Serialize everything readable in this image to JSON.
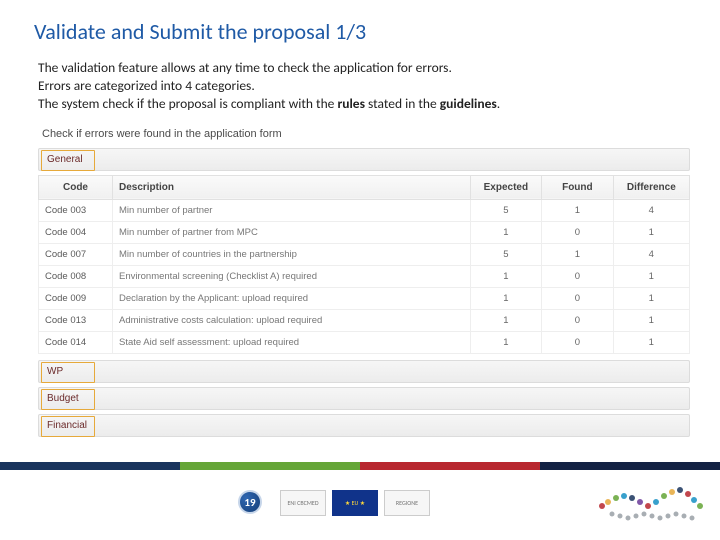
{
  "title": "Validate and Submit the proposal 1/3",
  "intro": {
    "line1": "The validation feature allows at any time to check the application for errors.",
    "line2": "Errors are categorized into 4 categories.",
    "line3a": "The system check if the proposal is compliant with the ",
    "line3b": "rules",
    "line3c": " stated in the ",
    "line3d": "guidelines",
    "line3e": "."
  },
  "panel_header": "Check if errors were found in the application form",
  "categories": {
    "general": "General",
    "wp": "WP",
    "budget": "Budget",
    "financial": "Financial"
  },
  "table": {
    "headers": {
      "code": "Code",
      "desc": "Description",
      "exp": "Expected",
      "found": "Found",
      "diff": "Difference"
    },
    "rows": [
      {
        "code": "Code 003",
        "desc": "Min number of partner",
        "exp": "5",
        "found": "1",
        "diff": "4"
      },
      {
        "code": "Code 004",
        "desc": "Min number of partner from MPC",
        "exp": "1",
        "found": "0",
        "diff": "1"
      },
      {
        "code": "Code 007",
        "desc": "Min number of countries in the partnership",
        "exp": "5",
        "found": "1",
        "diff": "4"
      },
      {
        "code": "Code 008",
        "desc": "Environmental screening (Checklist A) required",
        "exp": "1",
        "found": "0",
        "diff": "1"
      },
      {
        "code": "Code 009",
        "desc": "Declaration by the Applicant: upload required",
        "exp": "1",
        "found": "0",
        "diff": "1"
      },
      {
        "code": "Code 013",
        "desc": "Administrative costs calculation: upload required",
        "exp": "1",
        "found": "0",
        "diff": "1"
      },
      {
        "code": "Code 014",
        "desc": "State Aid self assessment: upload required",
        "exp": "1",
        "found": "0",
        "diff": "1"
      }
    ]
  },
  "page_number": "19",
  "logos": {
    "eni": "ENI CBCMED",
    "eu": "★ EU ★",
    "it": "REGIONE"
  }
}
